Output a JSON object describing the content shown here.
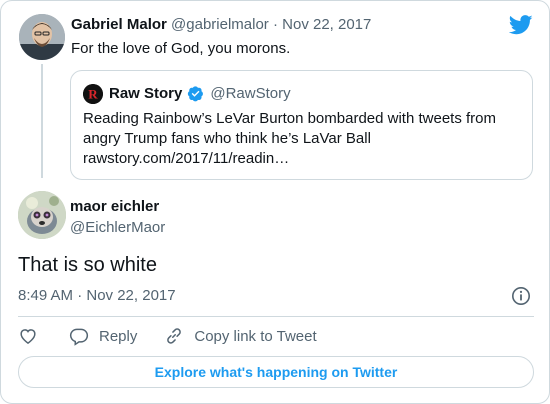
{
  "parent_tweet": {
    "author_name": "Gabriel Malor",
    "handle": "@gabrielmalor",
    "separator": "·",
    "date": "Nov 22, 2017",
    "text": "For the love of God, you morons.",
    "avatar_icon": "user-avatar-photo"
  },
  "quoted_tweet": {
    "author_name": "Raw Story",
    "handle": "@RawStory",
    "verified_icon": "verified-badge-icon",
    "text_lines": [
      "Reading Rainbow’s LeVar Burton bombarded with tweets from",
      "angry Trump fans who think he’s LaVar Ball",
      "rawstory.com/2017/11/readin…"
    ]
  },
  "main_tweet": {
    "author_name": "maor eichler",
    "handle": "@EichlerMaor",
    "text": "That is so white",
    "timestamp": "8:49 AM · Nov 22, 2017",
    "avatar_icon": "user-avatar-photo"
  },
  "actions": {
    "like_icon": "heart-icon",
    "reply_label": "Reply",
    "copy_label": "Copy link to Tweet"
  },
  "explore_label": "Explore what's happening on Twitter",
  "colors": {
    "accent": "#1d9bf0",
    "text": "#0f1419",
    "secondary": "#536471",
    "border": "#cfd9de"
  }
}
